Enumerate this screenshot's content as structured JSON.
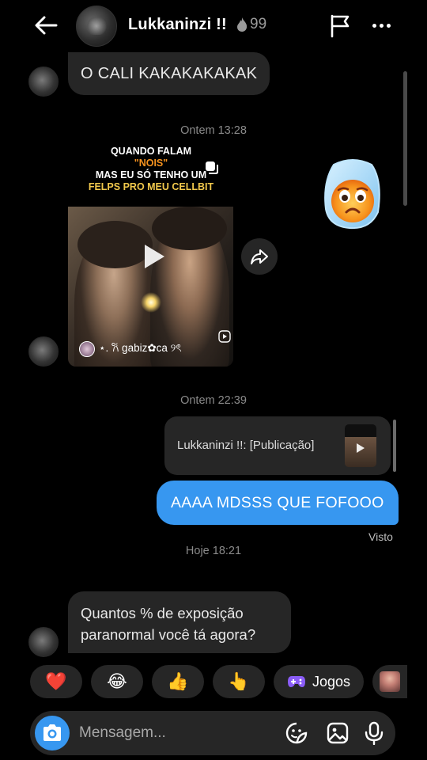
{
  "header": {
    "name": "Lukkaninzi !!",
    "streak_count": "99"
  },
  "messages": {
    "first": "O CALI KAKAKAKAKAK",
    "time_1": "Ontem 13:28",
    "post": {
      "caption_line1": "QUANDO FALAM",
      "caption_line2": "\"NOIS\"",
      "caption_line3": "MAS EU SÓ TENHO UM",
      "caption_line4": "FELPS PRO MEU CELLBIT",
      "author": "⋆. 𐙚 gabiz✿ca ୨ৎ"
    },
    "time_2": "Ontem 22:39",
    "reply_preview": "Lukkaninzi !!: [Publicação]",
    "outgoing": "AAAA MDSSS QUE FOFOOO",
    "seen": "Visto",
    "time_3": "Hoje 18:21",
    "last": "Quantos % de exposição paranormal você tá agora?"
  },
  "quick_replies": {
    "heart": "❤️",
    "laugh": "😂",
    "thumbs": "👍",
    "point": "👆",
    "games": "Jogos"
  },
  "composer": {
    "placeholder": "Mensagem..."
  },
  "colors": {
    "accent": "#3797f0",
    "bubble": "#262626",
    "background": "#000000"
  }
}
